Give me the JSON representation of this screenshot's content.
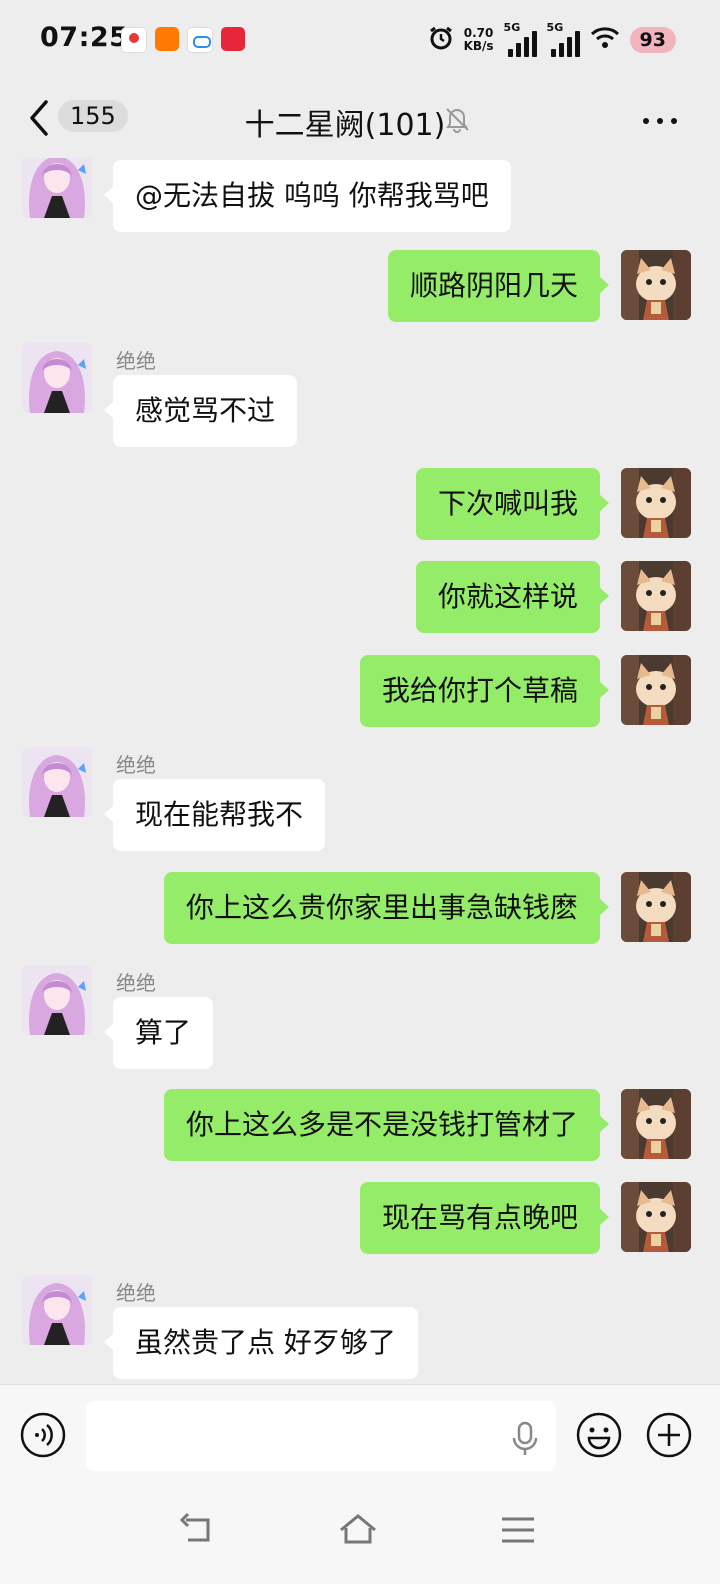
{
  "status_bar": {
    "time": "07:25",
    "net_speed_value": "0.70",
    "net_speed_unit": "KB/s",
    "sim1_tag": "5G",
    "sim2_tag": "5G",
    "battery": "93",
    "app_icons": [
      "location-app-icon",
      "taobao-flash-icon",
      "cloud-app-icon",
      "red-app-icon"
    ]
  },
  "header": {
    "unread_count": "155",
    "title": "十二星阙(101)",
    "muted": true
  },
  "messages": [
    {
      "side": "in",
      "sender": "",
      "text": "@无法自拔  呜呜 你帮我骂吧"
    },
    {
      "side": "out",
      "text": "顺路阴阳几天"
    },
    {
      "side": "in",
      "sender": "绝绝",
      "text": "感觉骂不过"
    },
    {
      "side": "out",
      "text": "下次喊叫我"
    },
    {
      "side": "out",
      "text": "你就这样说"
    },
    {
      "side": "out",
      "text": "我给你打个草稿"
    },
    {
      "side": "in",
      "sender": "绝绝",
      "text": "现在能帮我不"
    },
    {
      "side": "out",
      "text": "你上这么贵你家里出事急缺钱麽"
    },
    {
      "side": "in",
      "sender": "绝绝",
      "text": "算了"
    },
    {
      "side": "out",
      "text": "你上这么多是不是没钱打管材了"
    },
    {
      "side": "out",
      "text": "现在骂有点晚吧"
    },
    {
      "side": "in",
      "sender": "绝绝",
      "text": "虽然贵了点 好歹够了"
    }
  ],
  "input": {
    "placeholder": ""
  },
  "colors": {
    "background": "#ededed",
    "out_bubble": "#95ec69",
    "in_bubble": "#ffffff",
    "battery_badge": "#f2b4bd"
  }
}
